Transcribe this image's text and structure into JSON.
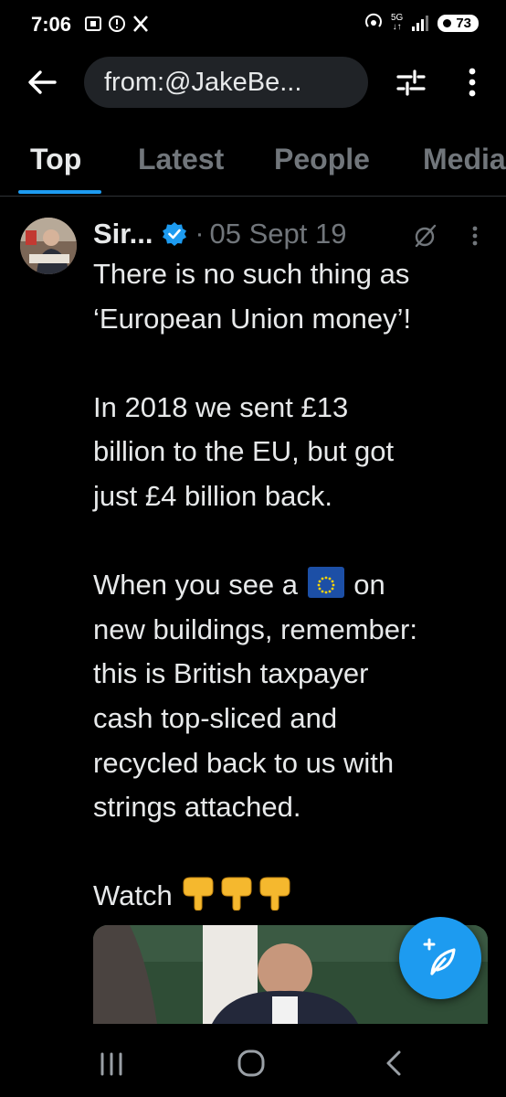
{
  "status_bar": {
    "time": "7:06",
    "network": "5G",
    "battery": "73",
    "icons": [
      "screenshot-icon",
      "alert-icon",
      "x-logo-icon",
      "hotspot-icon",
      "signal-icon",
      "battery-icon"
    ]
  },
  "search": {
    "query": "from:@JakeBe...",
    "icons": [
      "back-arrow-icon",
      "filter-sliders-icon",
      "more-vertical-icon"
    ]
  },
  "tabs": [
    {
      "label": "Top",
      "active": true
    },
    {
      "label": "Latest",
      "active": false
    },
    {
      "label": "People",
      "active": false
    },
    {
      "label": "Media",
      "active": false
    }
  ],
  "tweet": {
    "author": "Sir...",
    "separator": "·",
    "date": "05 Sept 19",
    "lines": [
      "There is no such thing as",
      "‘European Union money’!",
      "",
      "In 2018 we sent £13",
      "billion to the EU, but got",
      "just £4 billion back.",
      "",
      "When you see a",
      "on",
      "new buildings, remember:",
      "this is British taxpayer",
      "cash top-sliced and",
      "recycled back to us with",
      "strings attached.",
      "",
      "Watch"
    ],
    "emoji": [
      "eu-flag-icon",
      "backhand-index-pointing-down-icon"
    ]
  },
  "colors": {
    "background": "#000000",
    "accent": "#1d9bf0",
    "text_primary": "#e7e9ea",
    "text_secondary": "#71767b",
    "search_bg": "#202327"
  }
}
